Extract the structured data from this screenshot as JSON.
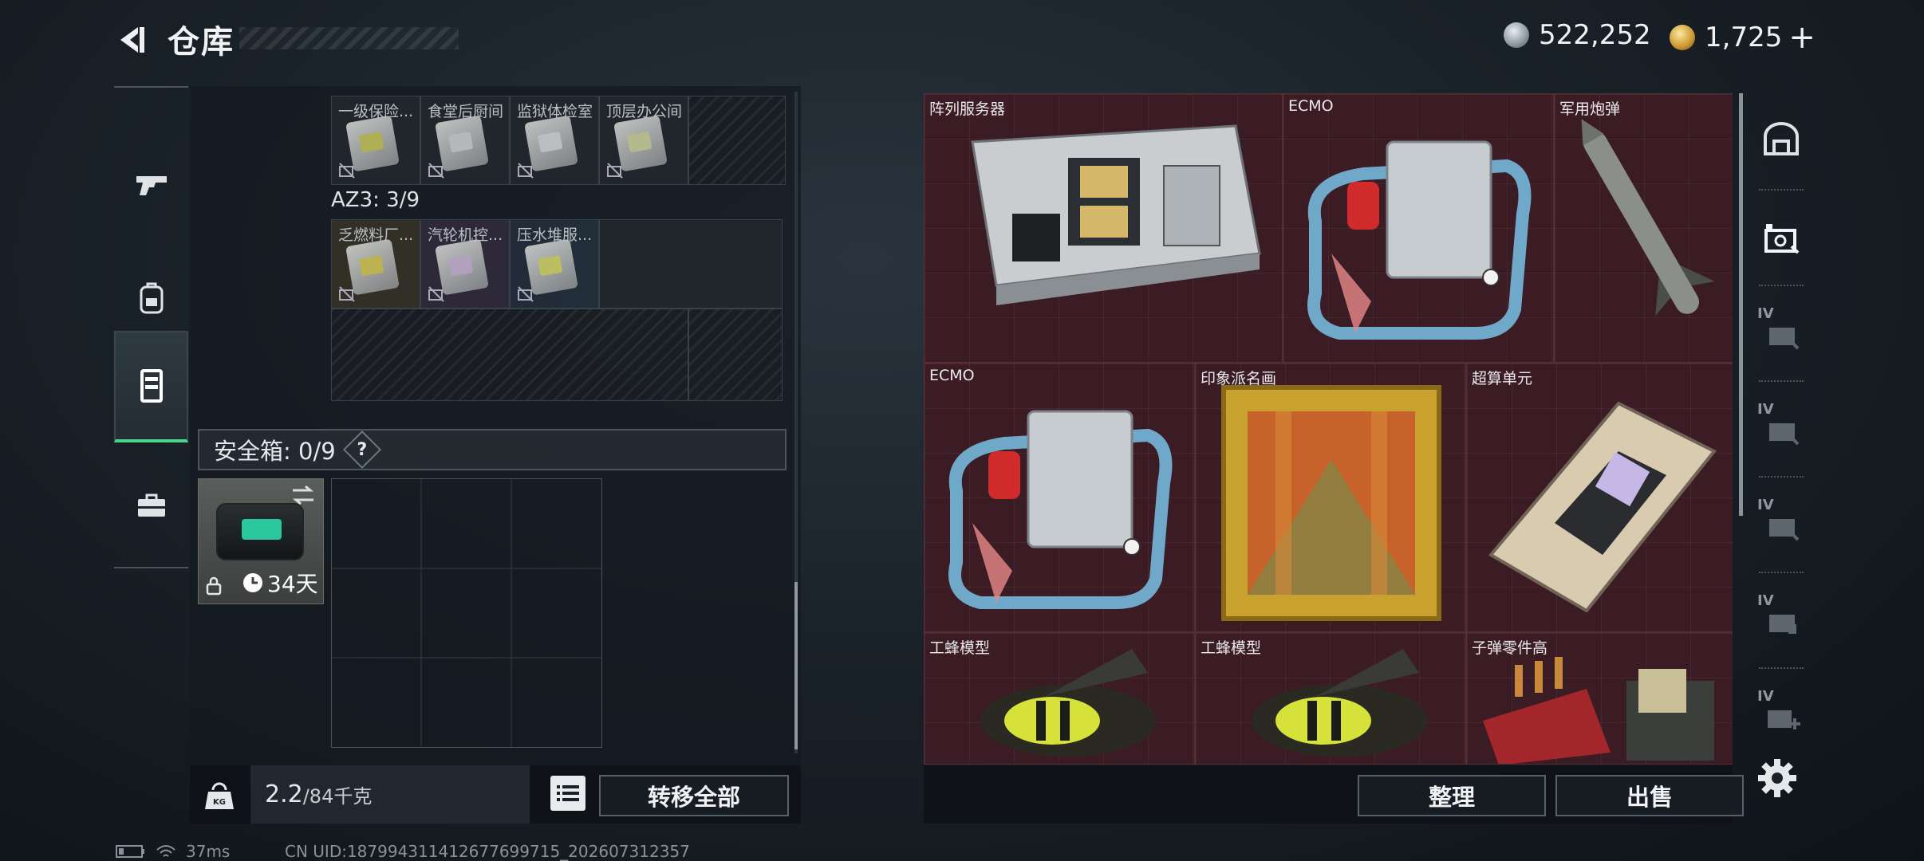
{
  "header": {
    "title": "仓库",
    "currency": [
      {
        "name": "silver",
        "amount": "522,252"
      },
      {
        "name": "gold",
        "amount": "1,725"
      }
    ],
    "plus": "+"
  },
  "nav": {
    "items": [
      {
        "name": "weapons",
        "icon": "gun-icon"
      },
      {
        "name": "backpack",
        "icon": "backpack-icon"
      },
      {
        "name": "warehouse",
        "icon": "locker-icon",
        "active": true
      },
      {
        "name": "toolbox",
        "icon": "toolbox-icon"
      }
    ]
  },
  "stash": {
    "row1_items": [
      "一级保险...",
      "食堂后厨间",
      "监狱体检室",
      "顶层办公间"
    ],
    "az3_label": "AZ3: 3/9",
    "az3_items": [
      "乏燃料厂...",
      "汽轮机控...",
      "压水堆服..."
    ],
    "safe_label": "安全箱: 0/9",
    "help": "?",
    "safe_days": "34天"
  },
  "bottom_left": {
    "weight_value": "2.2",
    "weight_unit": "/84千克",
    "transfer_all": "转移全部"
  },
  "store_items": [
    {
      "label": "阵列服务器"
    },
    {
      "label": "ECMO"
    },
    {
      "label": "军用炮弹"
    },
    {
      "label": "ECMO"
    },
    {
      "label": "印象派名画"
    },
    {
      "label": "超算单元"
    },
    {
      "label": "工蜂模型"
    },
    {
      "label": "工蜂模型"
    },
    {
      "label": "子弹零件高"
    }
  ],
  "bottom_right": {
    "organize": "整理",
    "sell": "出售"
  },
  "sidebar_right": {
    "roman": [
      "IV",
      "IV",
      "IV",
      "IV",
      "IV"
    ]
  },
  "status": {
    "ping": "37ms",
    "uid": "CN UID:18799431141267769971​5_202607312357"
  }
}
